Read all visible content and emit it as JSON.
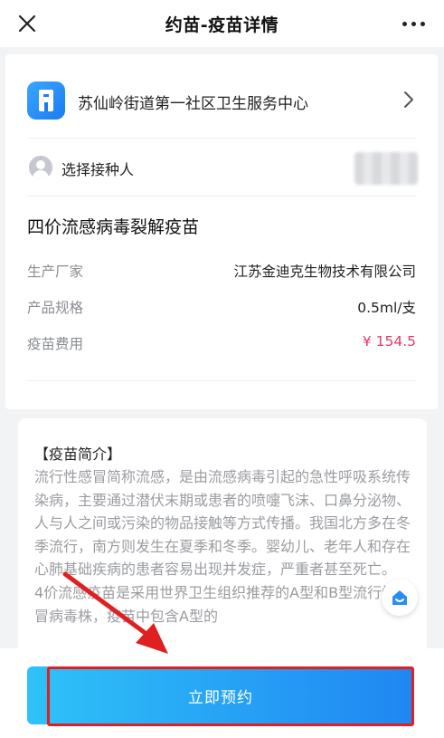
{
  "nav": {
    "title": "约苗-疫苗详情",
    "close_icon": "close-icon",
    "more_icon": "more-icon"
  },
  "clinic": {
    "name": "苏仙岭街道第一社区卫生服务中心",
    "icon": "building-icon"
  },
  "recipient": {
    "label": "选择接种人",
    "icon": "user-avatar-icon"
  },
  "vaccine": {
    "name": "四价流感病毒裂解疫苗",
    "rows": [
      {
        "key": "生产厂家",
        "value": "江苏金迪克生物技术有限公司"
      },
      {
        "key": "产品规格",
        "value": "0.5ml/支"
      },
      {
        "key": "疫苗费用",
        "value": "¥ 154.5"
      }
    ]
  },
  "intro": {
    "title": "【疫苗简介】",
    "paragraphs": [
      "流行性感冒简称流感，是由流感病毒引起的急性呼吸系统传染病，主要通过潜伏末期或患者的喷嚏飞沫、口鼻分泌物、人与人之间或污染的物品接触等方式传播。我国北方多在冬季流行，南方则发生在夏季和冬季。婴幼儿、老年人和存在心肺基础疾病的患者容易出现并发症，严重者甚至死亡。",
      "4价流感疫苗是采用世界卫生组织推荐的A型和B型流行性感冒病毒株，疫苗中包含A型的"
    ]
  },
  "actions": {
    "book_label": "立即预约"
  },
  "colors": {
    "accent": "#1f86f2",
    "price": "#e03a66",
    "annotation": "#e02020"
  }
}
